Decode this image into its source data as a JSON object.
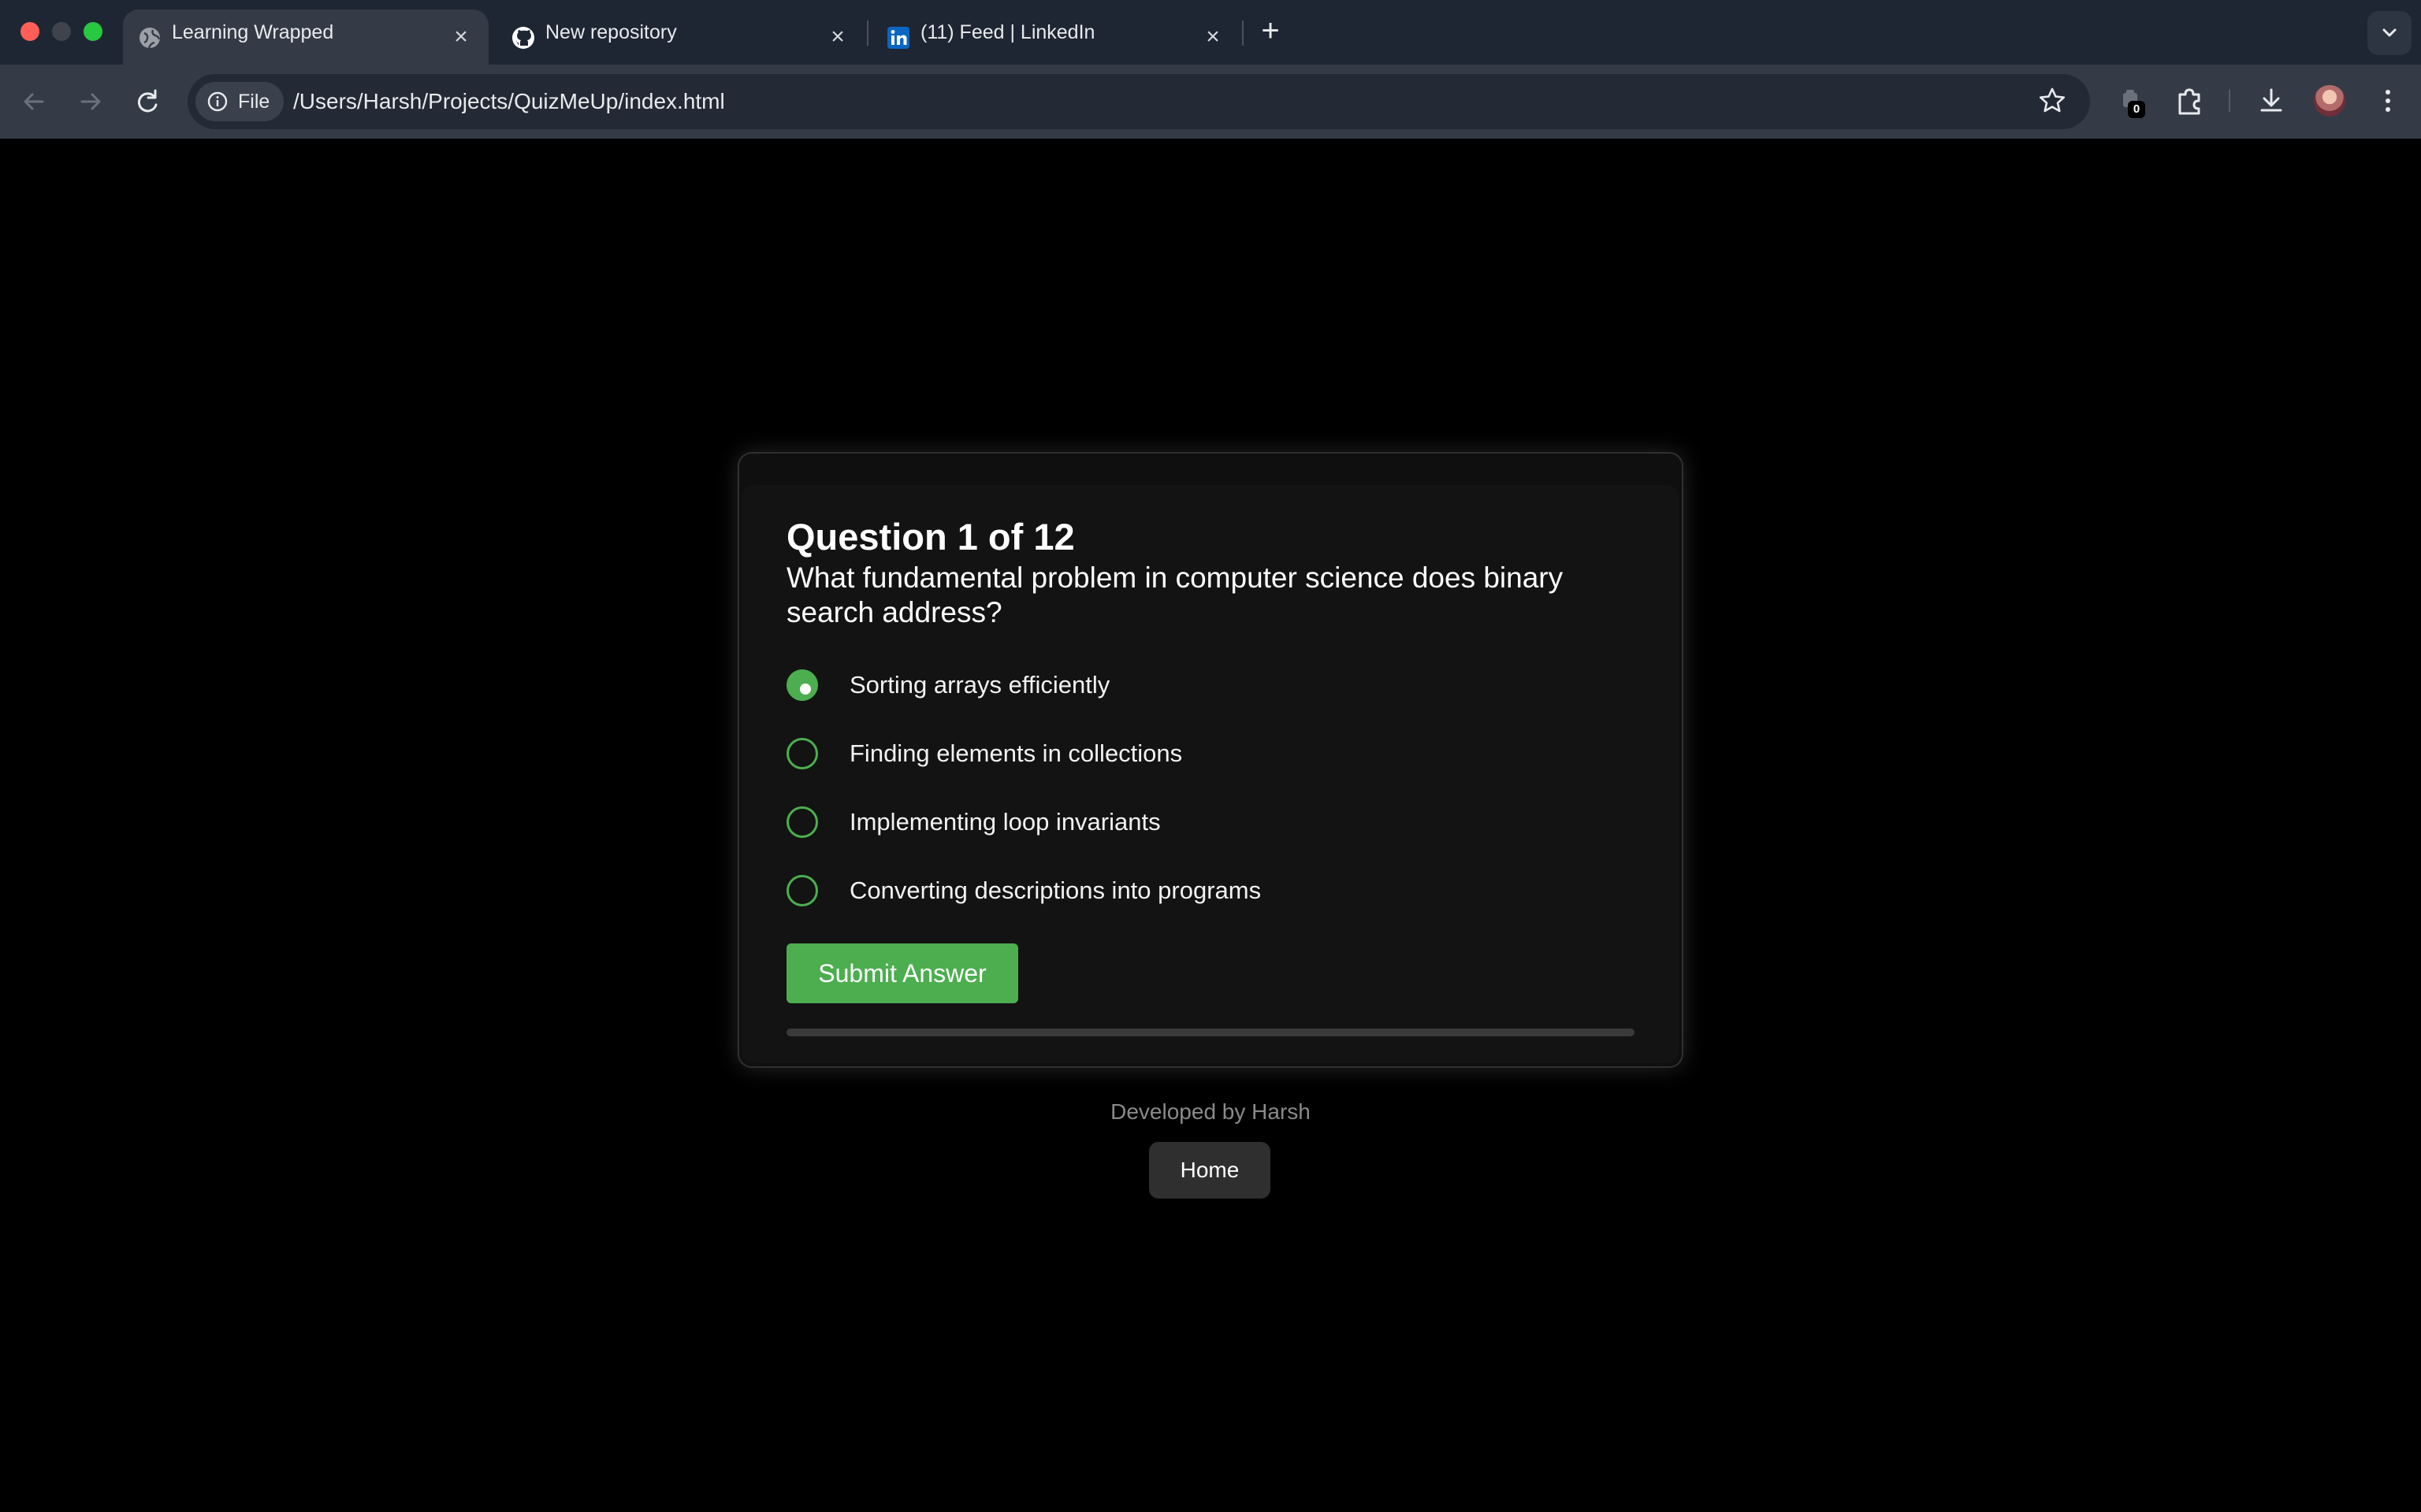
{
  "browser": {
    "tabs": [
      {
        "title": "Learning Wrapped",
        "icon": "globe-icon",
        "active": true
      },
      {
        "title": "New repository",
        "icon": "github-icon",
        "active": false
      },
      {
        "title": "(11) Feed | LinkedIn",
        "icon": "linkedin-icon",
        "active": false
      }
    ],
    "address": {
      "scheme_label": "File",
      "url": "/Users/Harsh/Projects/QuizMeUp/index.html"
    },
    "extension_badge": "0"
  },
  "quiz": {
    "heading": "Question 1 of 12",
    "question": "What fundamental problem in computer science does binary search address?",
    "options": [
      {
        "label": "Sorting arrays efficiently",
        "selected": true
      },
      {
        "label": "Finding elements in collections",
        "selected": false
      },
      {
        "label": "Implementing loop invariants",
        "selected": false
      },
      {
        "label": "Converting descriptions into programs",
        "selected": false
      }
    ],
    "submit_label": "Submit Answer",
    "progress": 0
  },
  "footer": {
    "credit": "Developed by Harsh",
    "home_label": "Home"
  },
  "colors": {
    "accent": "#4cae4f",
    "page_background": "#000000",
    "card_background": "#131313",
    "browser_frame": "#1f2633",
    "toolbar": "#343b47"
  }
}
